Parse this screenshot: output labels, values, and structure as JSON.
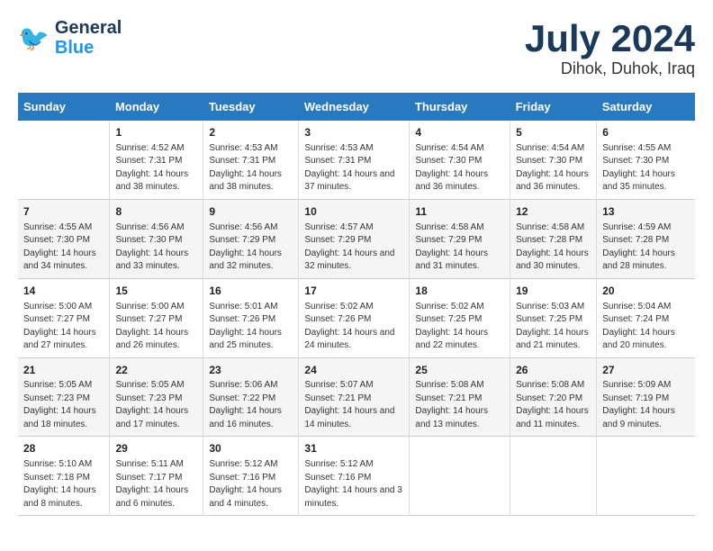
{
  "header": {
    "logo_line1": "General",
    "logo_line2": "Blue",
    "month_year": "July 2024",
    "location": "Dihok, Duhok, Iraq"
  },
  "days_of_week": [
    "Sunday",
    "Monday",
    "Tuesday",
    "Wednesday",
    "Thursday",
    "Friday",
    "Saturday"
  ],
  "weeks": [
    [
      {
        "date": "",
        "info": ""
      },
      {
        "date": "1",
        "info": "Sunrise: 4:52 AM\nSunset: 7:31 PM\nDaylight: 14 hours\nand 38 minutes."
      },
      {
        "date": "2",
        "info": "Sunrise: 4:53 AM\nSunset: 7:31 PM\nDaylight: 14 hours\nand 38 minutes."
      },
      {
        "date": "3",
        "info": "Sunrise: 4:53 AM\nSunset: 7:31 PM\nDaylight: 14 hours\nand 37 minutes."
      },
      {
        "date": "4",
        "info": "Sunrise: 4:54 AM\nSunset: 7:30 PM\nDaylight: 14 hours\nand 36 minutes."
      },
      {
        "date": "5",
        "info": "Sunrise: 4:54 AM\nSunset: 7:30 PM\nDaylight: 14 hours\nand 36 minutes."
      },
      {
        "date": "6",
        "info": "Sunrise: 4:55 AM\nSunset: 7:30 PM\nDaylight: 14 hours\nand 35 minutes."
      }
    ],
    [
      {
        "date": "7",
        "info": "Sunrise: 4:55 AM\nSunset: 7:30 PM\nDaylight: 14 hours\nand 34 minutes."
      },
      {
        "date": "8",
        "info": "Sunrise: 4:56 AM\nSunset: 7:30 PM\nDaylight: 14 hours\nand 33 minutes."
      },
      {
        "date": "9",
        "info": "Sunrise: 4:56 AM\nSunset: 7:29 PM\nDaylight: 14 hours\nand 32 minutes."
      },
      {
        "date": "10",
        "info": "Sunrise: 4:57 AM\nSunset: 7:29 PM\nDaylight: 14 hours\nand 32 minutes."
      },
      {
        "date": "11",
        "info": "Sunrise: 4:58 AM\nSunset: 7:29 PM\nDaylight: 14 hours\nand 31 minutes."
      },
      {
        "date": "12",
        "info": "Sunrise: 4:58 AM\nSunset: 7:28 PM\nDaylight: 14 hours\nand 30 minutes."
      },
      {
        "date": "13",
        "info": "Sunrise: 4:59 AM\nSunset: 7:28 PM\nDaylight: 14 hours\nand 28 minutes."
      }
    ],
    [
      {
        "date": "14",
        "info": "Sunrise: 5:00 AM\nSunset: 7:27 PM\nDaylight: 14 hours\nand 27 minutes."
      },
      {
        "date": "15",
        "info": "Sunrise: 5:00 AM\nSunset: 7:27 PM\nDaylight: 14 hours\nand 26 minutes."
      },
      {
        "date": "16",
        "info": "Sunrise: 5:01 AM\nSunset: 7:26 PM\nDaylight: 14 hours\nand 25 minutes."
      },
      {
        "date": "17",
        "info": "Sunrise: 5:02 AM\nSunset: 7:26 PM\nDaylight: 14 hours\nand 24 minutes."
      },
      {
        "date": "18",
        "info": "Sunrise: 5:02 AM\nSunset: 7:25 PM\nDaylight: 14 hours\nand 22 minutes."
      },
      {
        "date": "19",
        "info": "Sunrise: 5:03 AM\nSunset: 7:25 PM\nDaylight: 14 hours\nand 21 minutes."
      },
      {
        "date": "20",
        "info": "Sunrise: 5:04 AM\nSunset: 7:24 PM\nDaylight: 14 hours\nand 20 minutes."
      }
    ],
    [
      {
        "date": "21",
        "info": "Sunrise: 5:05 AM\nSunset: 7:23 PM\nDaylight: 14 hours\nand 18 minutes."
      },
      {
        "date": "22",
        "info": "Sunrise: 5:05 AM\nSunset: 7:23 PM\nDaylight: 14 hours\nand 17 minutes."
      },
      {
        "date": "23",
        "info": "Sunrise: 5:06 AM\nSunset: 7:22 PM\nDaylight: 14 hours\nand 16 minutes."
      },
      {
        "date": "24",
        "info": "Sunrise: 5:07 AM\nSunset: 7:21 PM\nDaylight: 14 hours\nand 14 minutes."
      },
      {
        "date": "25",
        "info": "Sunrise: 5:08 AM\nSunset: 7:21 PM\nDaylight: 14 hours\nand 13 minutes."
      },
      {
        "date": "26",
        "info": "Sunrise: 5:08 AM\nSunset: 7:20 PM\nDaylight: 14 hours\nand 11 minutes."
      },
      {
        "date": "27",
        "info": "Sunrise: 5:09 AM\nSunset: 7:19 PM\nDaylight: 14 hours\nand 9 minutes."
      }
    ],
    [
      {
        "date": "28",
        "info": "Sunrise: 5:10 AM\nSunset: 7:18 PM\nDaylight: 14 hours\nand 8 minutes."
      },
      {
        "date": "29",
        "info": "Sunrise: 5:11 AM\nSunset: 7:17 PM\nDaylight: 14 hours\nand 6 minutes."
      },
      {
        "date": "30",
        "info": "Sunrise: 5:12 AM\nSunset: 7:16 PM\nDaylight: 14 hours\nand 4 minutes."
      },
      {
        "date": "31",
        "info": "Sunrise: 5:12 AM\nSunset: 7:16 PM\nDaylight: 14 hours\nand 3 minutes."
      },
      {
        "date": "",
        "info": ""
      },
      {
        "date": "",
        "info": ""
      },
      {
        "date": "",
        "info": ""
      }
    ]
  ]
}
